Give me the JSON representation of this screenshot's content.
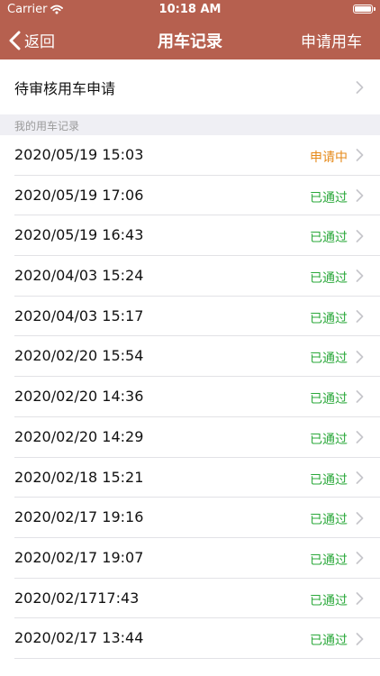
{
  "statusbar": {
    "carrier": "Carrier",
    "time": "10:18 AM"
  },
  "nav": {
    "back_label": "返回",
    "title": "用车记录",
    "action_label": "申请用车"
  },
  "pending_requests": {
    "label": "待审核用车申请"
  },
  "section": {
    "title": "我的用车记录"
  },
  "colors": {
    "header_bg": "#b6604f",
    "approved": "#2aa83a",
    "pending": "#e68a1a"
  },
  "records": [
    {
      "date": "2020/05/19 15:03",
      "status": "申请中",
      "state": "pending"
    },
    {
      "date": "2020/05/19 17:06",
      "status": "已通过",
      "state": "approved"
    },
    {
      "date": "2020/05/19 16:43",
      "status": "已通过",
      "state": "approved"
    },
    {
      "date": "2020/04/03 15:24",
      "status": "已通过",
      "state": "approved"
    },
    {
      "date": "2020/04/03 15:17",
      "status": "已通过",
      "state": "approved"
    },
    {
      "date": "2020/02/20 15:54",
      "status": "已通过",
      "state": "approved"
    },
    {
      "date": "2020/02/20 14:36",
      "status": "已通过",
      "state": "approved"
    },
    {
      "date": "2020/02/20 14:29",
      "status": "已通过",
      "state": "approved"
    },
    {
      "date": "2020/02/18 15:21",
      "status": "已通过",
      "state": "approved"
    },
    {
      "date": "2020/02/17 19:16",
      "status": "已通过",
      "state": "approved"
    },
    {
      "date": "2020/02/17 19:07",
      "status": "已通过",
      "state": "approved"
    },
    {
      "date": "2020/02/1717:43",
      "status": "已通过",
      "state": "approved"
    },
    {
      "date": "2020/02/17 13:44",
      "status": "已通过",
      "state": "approved"
    }
  ]
}
